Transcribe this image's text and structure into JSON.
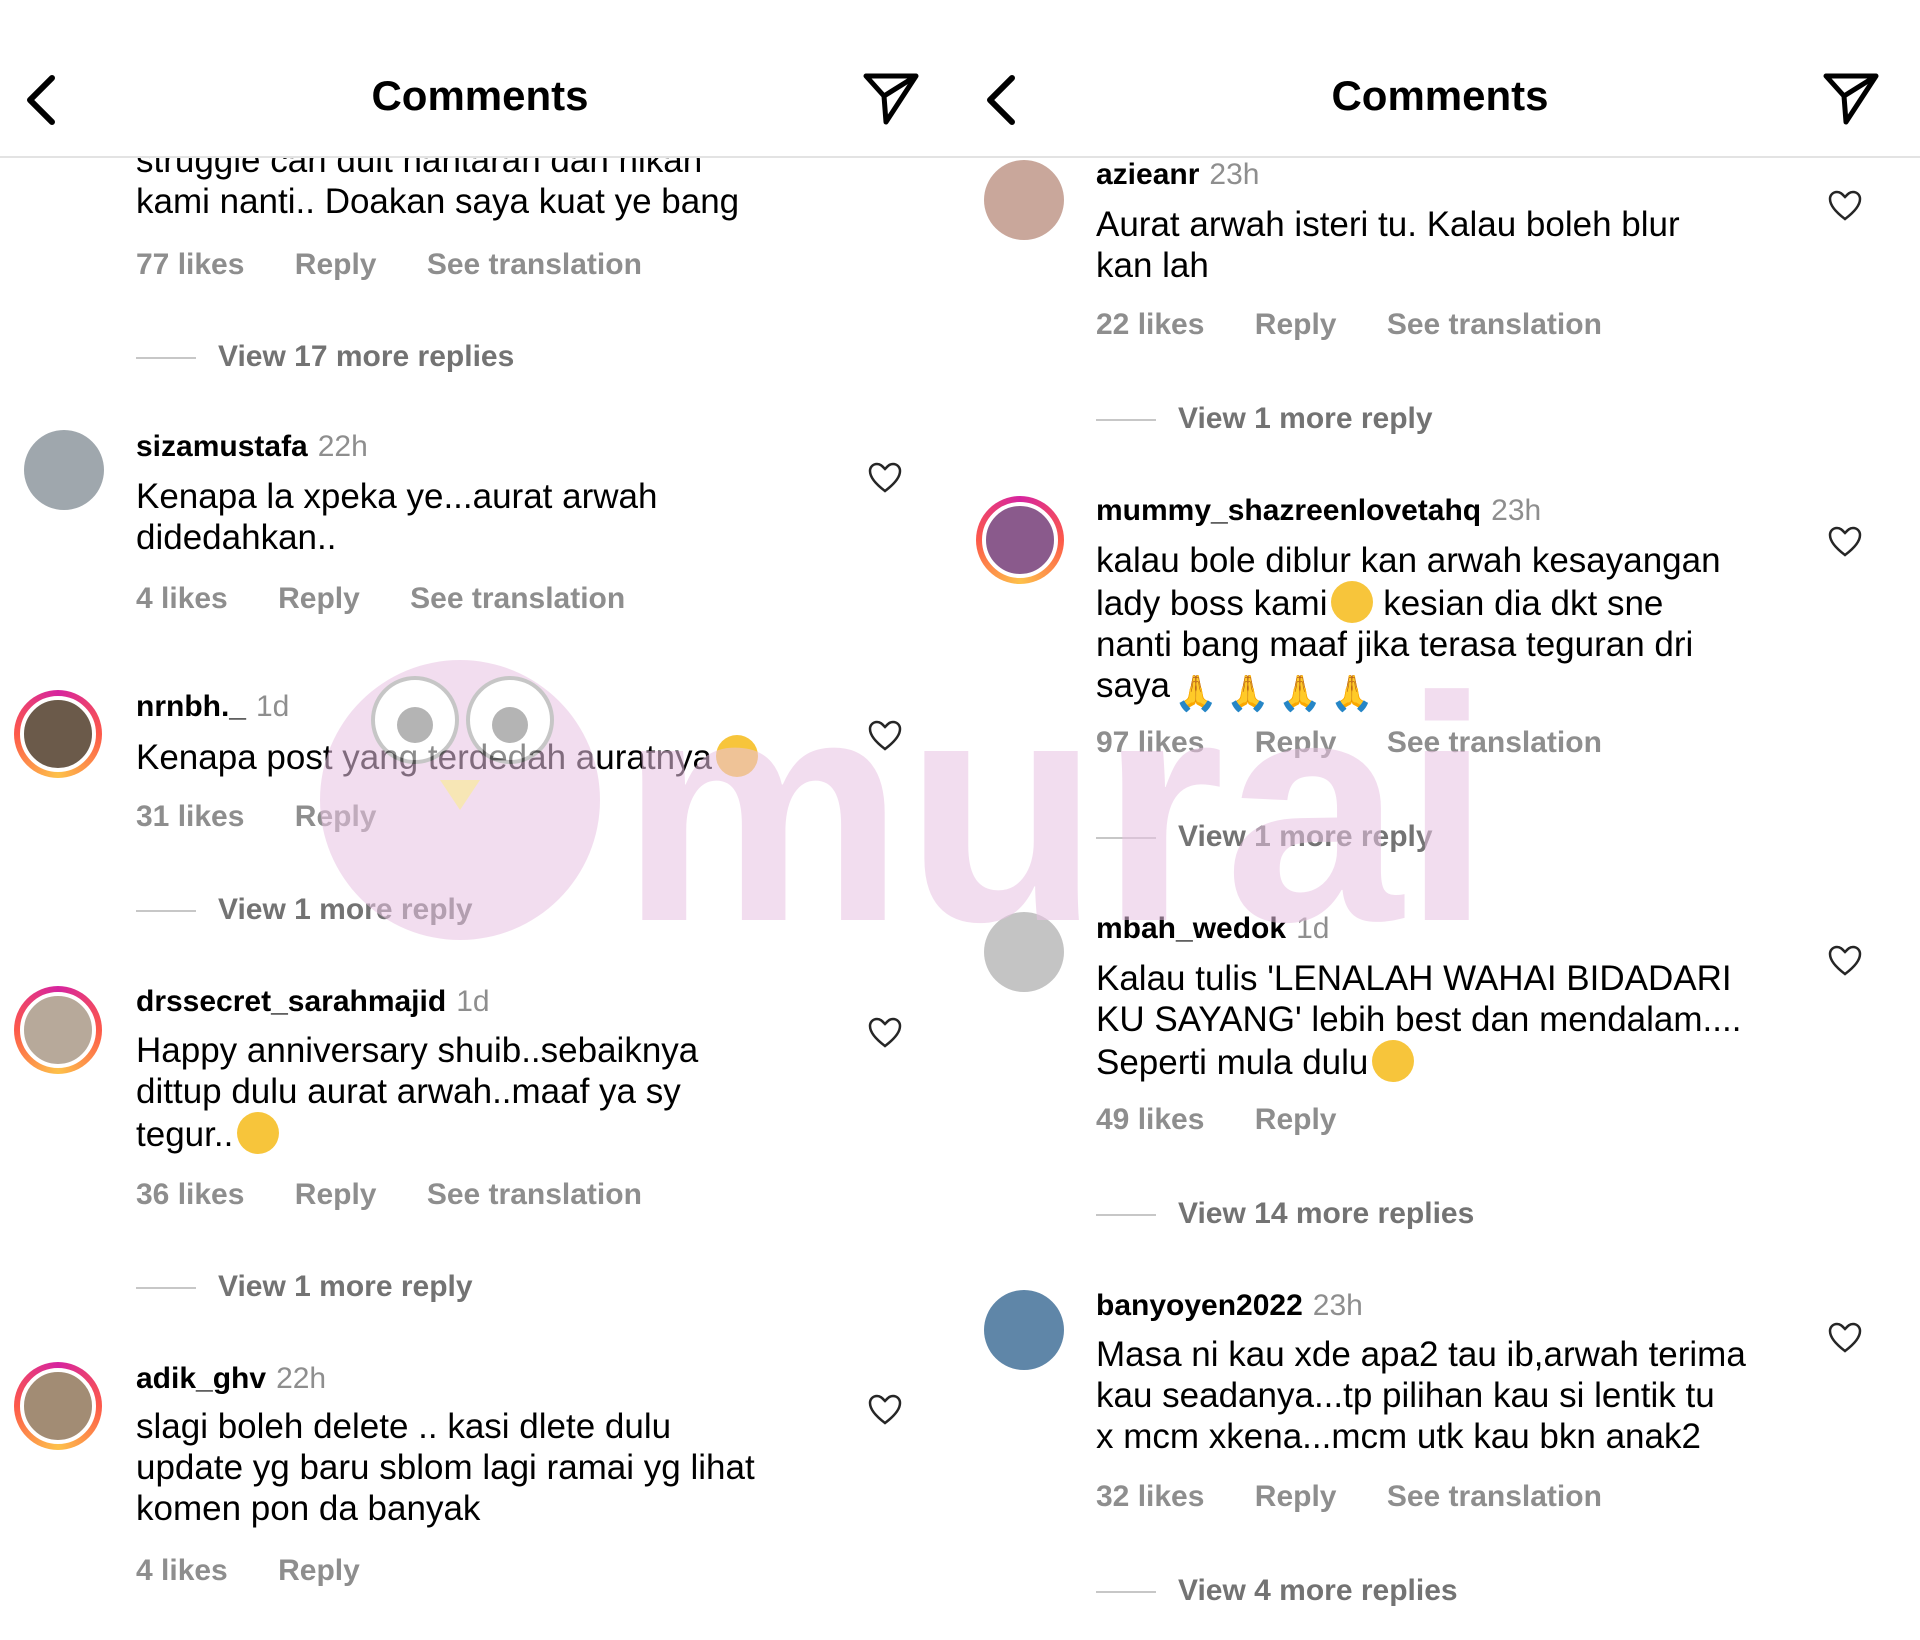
{
  "header_title": "Comments",
  "left": {
    "partial": {
      "text": "struggle cari duit hantaran dan nikah\nkami nanti.. Doakan saya kuat ye bang",
      "likes": "77 likes",
      "reply": "Reply",
      "translate": "See translation",
      "view_more": "View 17 more replies"
    },
    "comments": [
      {
        "user": "sizamustafa",
        "time": "22h",
        "text": "Kenapa la xpeka ye...aurat arwah\ndidedahkan..",
        "likes": "4 likes",
        "reply": "Reply",
        "translate": "See translation",
        "view_more": ""
      },
      {
        "user": "nrnbh._",
        "time": "1d",
        "text": "Kenapa post yang terdedah auratnya",
        "likes": "31 likes",
        "reply": "Reply",
        "translate": "",
        "view_more": "View 1 more reply"
      },
      {
        "user": "drssecret_sarahmajid",
        "time": "1d",
        "text": "Happy anniversary shuib..sebaiknya\ndittup dulu aurat arwah..maaf ya sy\ntegur..",
        "likes": "36 likes",
        "reply": "Reply",
        "translate": "See translation",
        "view_more": "View 1 more reply"
      },
      {
        "user": "adik_ghv",
        "time": "22h",
        "text": "slagi boleh delete .. kasi dlete dulu\nupdate yg baru sblom lagi ramai yg lihat\nkomen pon da banyak",
        "likes": "4 likes",
        "reply": "Reply",
        "translate": "",
        "view_more": ""
      }
    ]
  },
  "right": {
    "comments": [
      {
        "user": "azieanr",
        "time": "23h",
        "text": "Aurat arwah isteri tu. Kalau boleh blur\nkan lah",
        "likes": "22 likes",
        "reply": "Reply",
        "translate": "See translation",
        "view_more": "View 1 more reply"
      },
      {
        "user": "mummy_shazreenlovetahq",
        "time": "23h",
        "text": "kalau bole diblur kan arwah kesayangan\nlady boss kami",
        "text2": " kesian dia dkt sne\nnanti bang maaf jika terasa teguran dri\nsaya",
        "likes": "97 likes",
        "reply": "Reply",
        "translate": "See translation",
        "view_more": "View 1 more reply"
      },
      {
        "user": "mbah_wedok",
        "time": "1d",
        "text": "Kalau tulis 'LENALAH WAHAI BIDADARI\nKU SAYANG' lebih best dan mendalam....\nSeperti mula dulu",
        "likes": "49 likes",
        "reply": "Reply",
        "translate": "",
        "view_more": "View 14 more replies"
      },
      {
        "user": "banyoyen2022",
        "time": "23h",
        "text": "Masa ni kau xde apa2 tau ib,arwah terima\nkau seadanya...tp pilihan kau si lentik tu\nx mcm xkena...mcm utk kau bkn anak2",
        "likes": "32 likes",
        "reply": "Reply",
        "translate": "See translation",
        "view_more": "View 4 more replies"
      }
    ]
  },
  "watermark_text": "murai",
  "colors": {
    "meta": "#8e8e8e",
    "ring_start": "#d6249f",
    "ring_end": "#fdc14a",
    "watermark": "#e9c3e3"
  }
}
